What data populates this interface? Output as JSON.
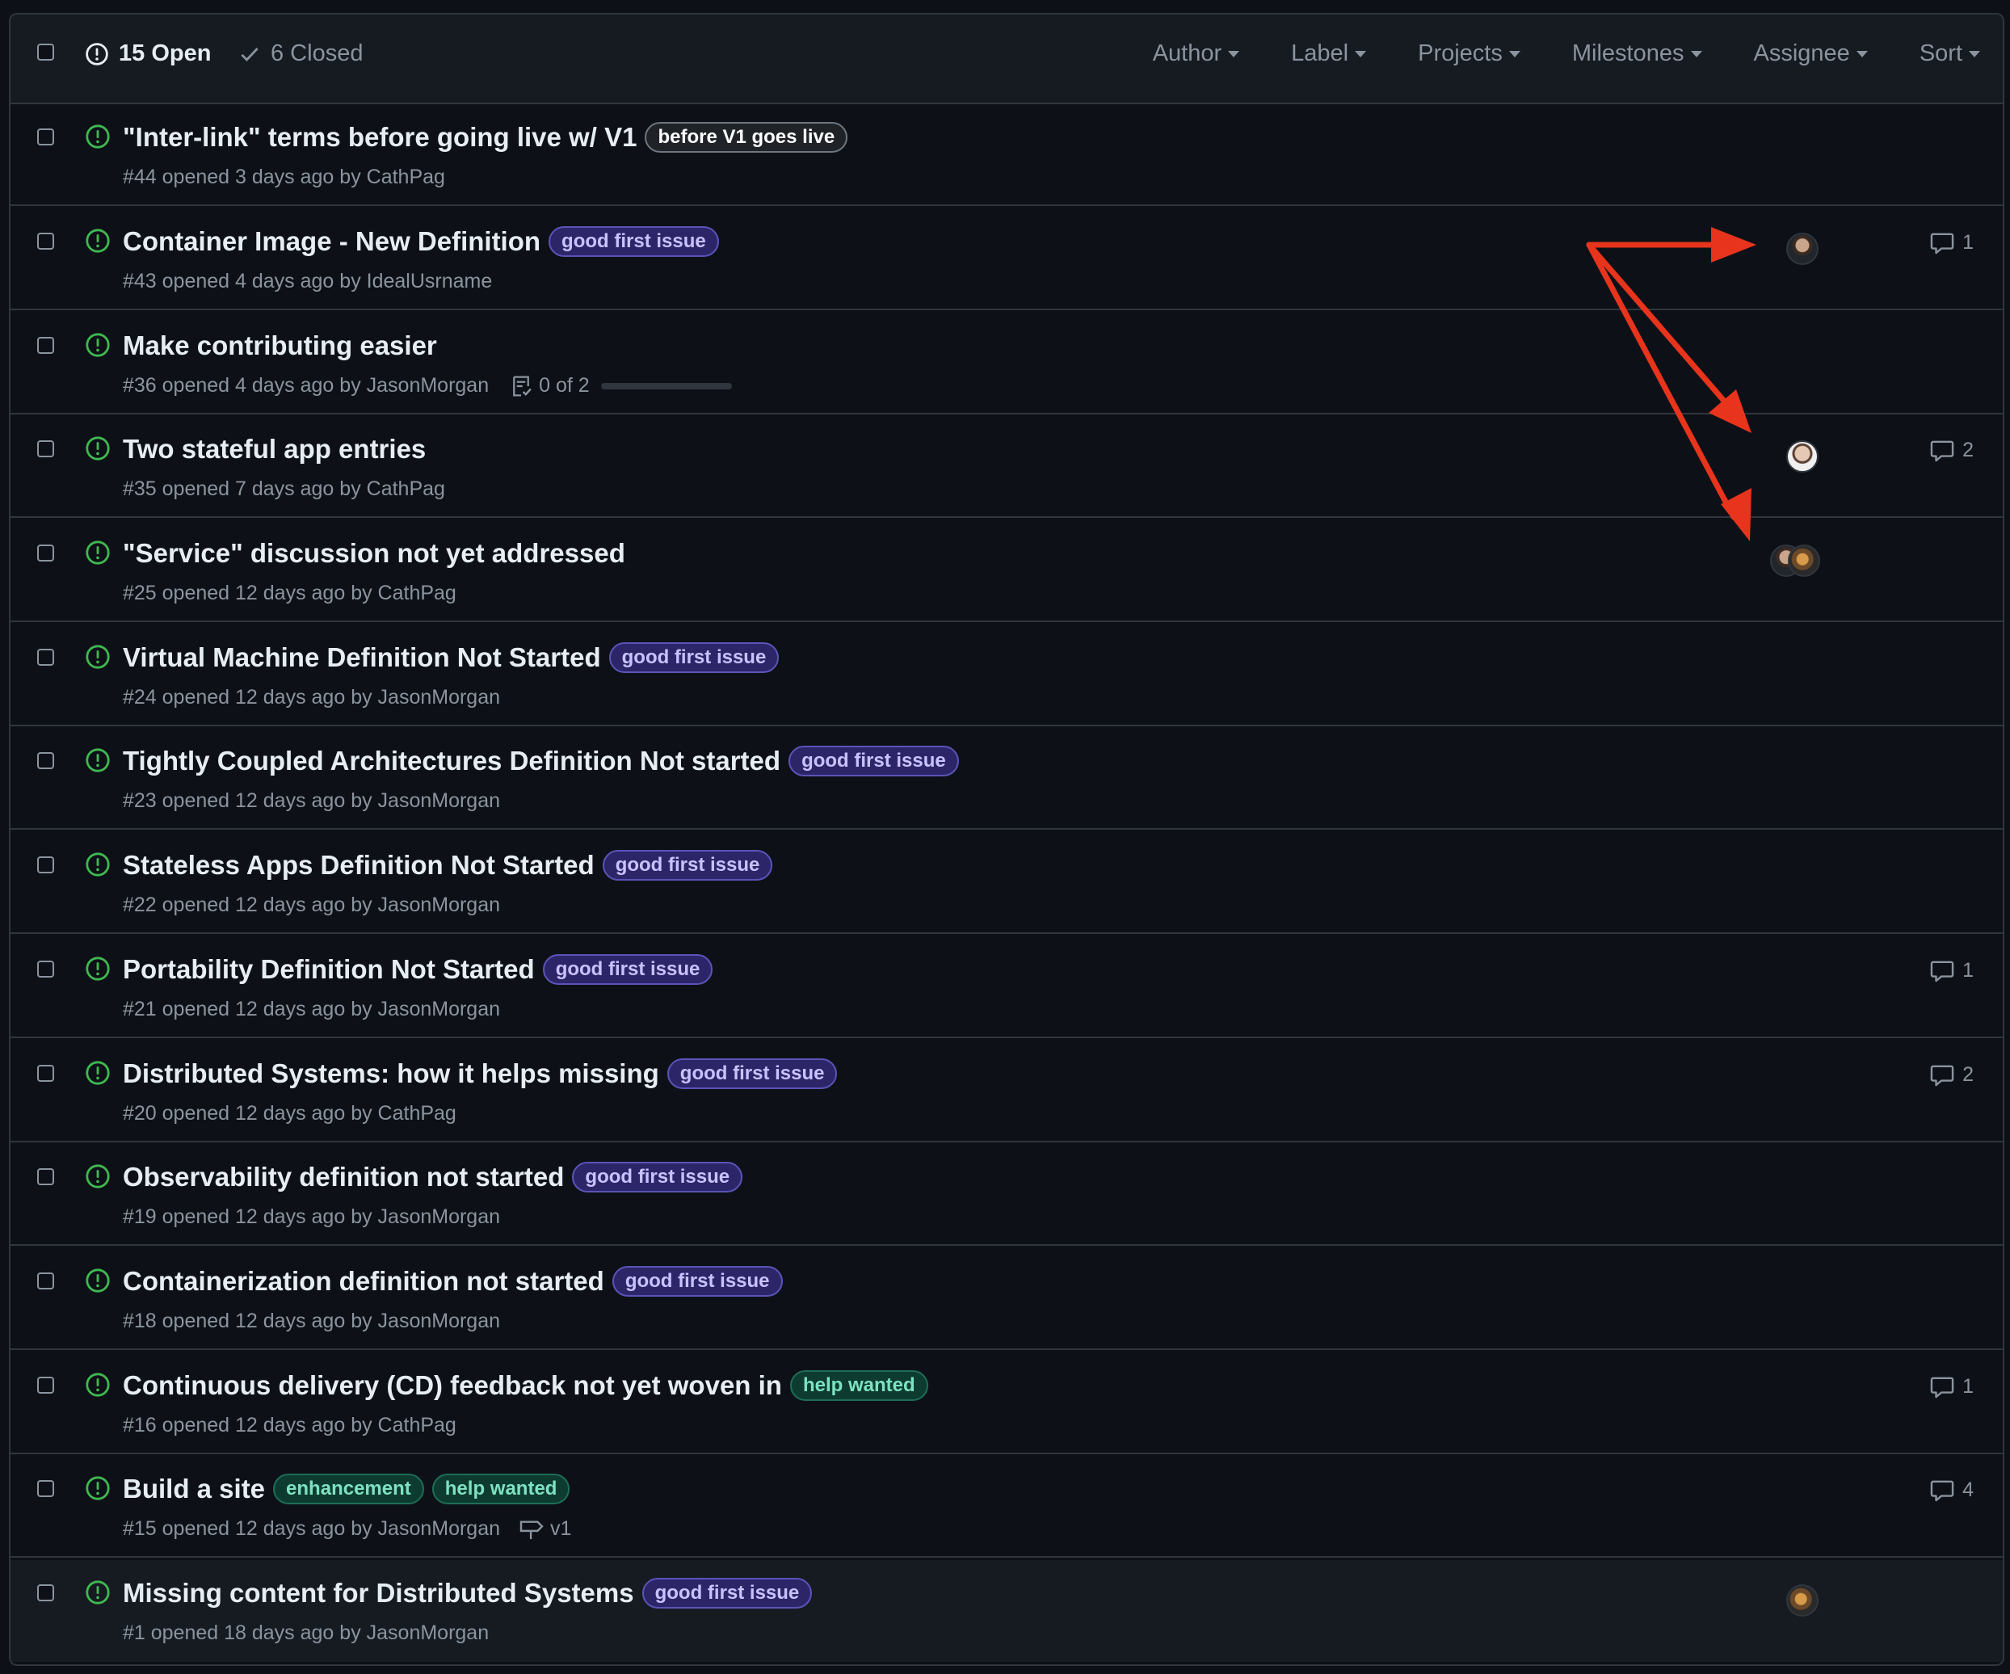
{
  "header": {
    "open_label": "15 Open",
    "closed_label": "6 Closed",
    "filters": [
      "Author",
      "Label",
      "Projects",
      "Milestones",
      "Assignee",
      "Sort"
    ]
  },
  "colors": {
    "open_icon": "#3fb950",
    "annotation_arrow": "#e8341c",
    "label_purple": "#c9c2ff",
    "label_green": "#7ee2c1"
  },
  "issues": [
    {
      "title": "\"Inter-link\" terms before going live w/ V1",
      "meta": "#44 opened 3 days ago by CathPag",
      "labels": [
        "before V1 goes live"
      ]
    },
    {
      "title": "Container Image - New Definition",
      "meta": "#43 opened 4 days ago by IdealUsrname",
      "labels": [
        "good first issue"
      ],
      "comments": "1"
    },
    {
      "title": "Make contributing easier",
      "meta": "#36 opened 4 days ago by JasonMorgan",
      "tasks": "0 of 2"
    },
    {
      "title": "Two stateful app entries",
      "meta": "#35 opened 7 days ago by CathPag",
      "comments": "2"
    },
    {
      "title": "\"Service\" discussion not yet addressed",
      "meta": "#25 opened 12 days ago by CathPag"
    },
    {
      "title": "Virtual Machine Definition Not Started",
      "meta": "#24 opened 12 days ago by JasonMorgan",
      "labels": [
        "good first issue"
      ]
    },
    {
      "title": "Tightly Coupled Architectures Definition Not started",
      "meta": "#23 opened 12 days ago by JasonMorgan",
      "labels": [
        "good first issue"
      ]
    },
    {
      "title": "Stateless Apps Definition Not Started",
      "meta": "#22 opened 12 days ago by JasonMorgan",
      "labels": [
        "good first issue"
      ]
    },
    {
      "title": "Portability Definition Not Started",
      "meta": "#21 opened 12 days ago by JasonMorgan",
      "labels": [
        "good first issue"
      ],
      "comments": "1"
    },
    {
      "title": "Distributed Systems: how it helps missing",
      "meta": "#20 opened 12 days ago by CathPag",
      "labels": [
        "good first issue"
      ],
      "comments": "2"
    },
    {
      "title": "Observability definition not started",
      "meta": "#19 opened 12 days ago by JasonMorgan",
      "labels": [
        "good first issue"
      ]
    },
    {
      "title": "Containerization definition not started",
      "meta": "#18 opened 12 days ago by JasonMorgan",
      "labels": [
        "good first issue"
      ]
    },
    {
      "title": "Continuous delivery (CD) feedback not yet woven in",
      "meta": "#16 opened 12 days ago by CathPag",
      "labels": [
        "help wanted"
      ],
      "comments": "1"
    },
    {
      "title": "Build a site",
      "meta": "#15 opened 12 days ago by JasonMorgan",
      "labels": [
        "enhancement",
        "help wanted"
      ],
      "milestone": "v1",
      "comments": "4"
    },
    {
      "title": "Missing content for Distributed Systems",
      "meta": "#1 opened 18 days ago by JasonMorgan",
      "labels": [
        "good first issue"
      ]
    }
  ]
}
